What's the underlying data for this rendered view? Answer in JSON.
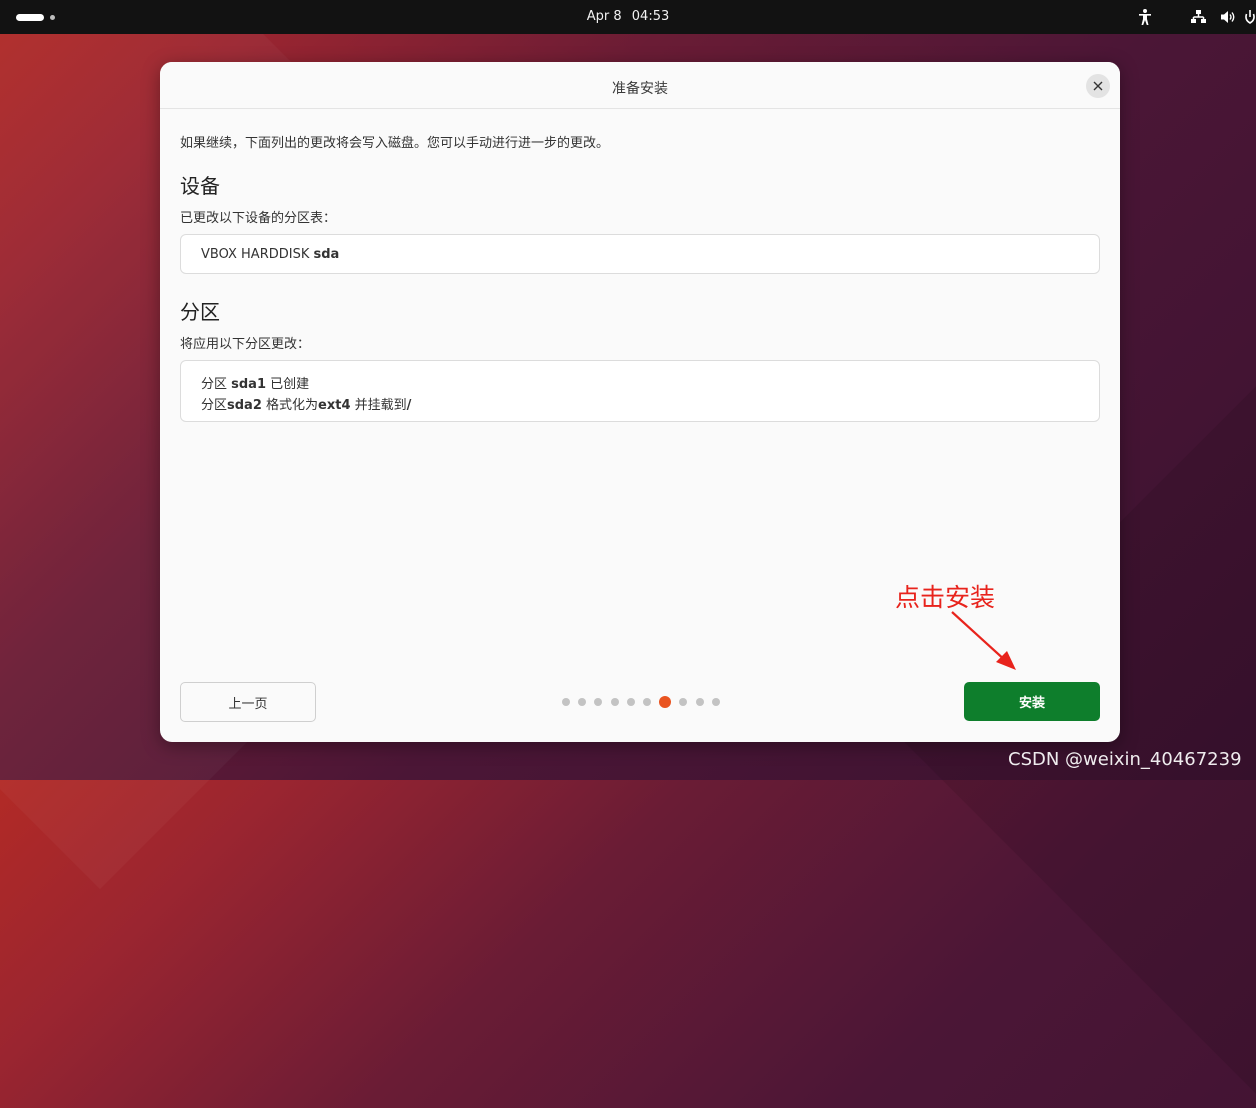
{
  "topbar": {
    "date": "Apr 8",
    "time": "04:53",
    "icons": [
      "activities-indicator",
      "accessibility-icon",
      "network-icon",
      "volume-icon",
      "power-icon"
    ]
  },
  "dialog": {
    "title": "准备安装",
    "intro": "如果继续，下面列出的更改将会写入磁盘。您可以手动进行进一步的更改。",
    "devices": {
      "title": "设备",
      "subtitle": "已更改以下设备的分区表：",
      "item_prefix": "VBOX HARDDISK",
      "item_device": "sda"
    },
    "partitions": {
      "title": "分区",
      "subtitle": "将应用以下分区更改：",
      "line1": {
        "p1": "分区 ",
        "b1": "sda1",
        "p2": " 已创建"
      },
      "line2": {
        "p1": "分区",
        "b1": "sda2",
        "p2": " 格式化为",
        "b2": "ext4",
        "p3": " 并挂载到",
        "b3": "/"
      }
    },
    "back_label": "上一页",
    "install_label": "安装",
    "progress": {
      "total_steps": 10,
      "current_step": 7
    }
  },
  "annotation": {
    "text": "点击安装",
    "color": "#e8231c"
  },
  "watermark": "CSDN @weixin_40467239",
  "colors": {
    "accent": "#e95420",
    "install": "#0e7e2c"
  }
}
